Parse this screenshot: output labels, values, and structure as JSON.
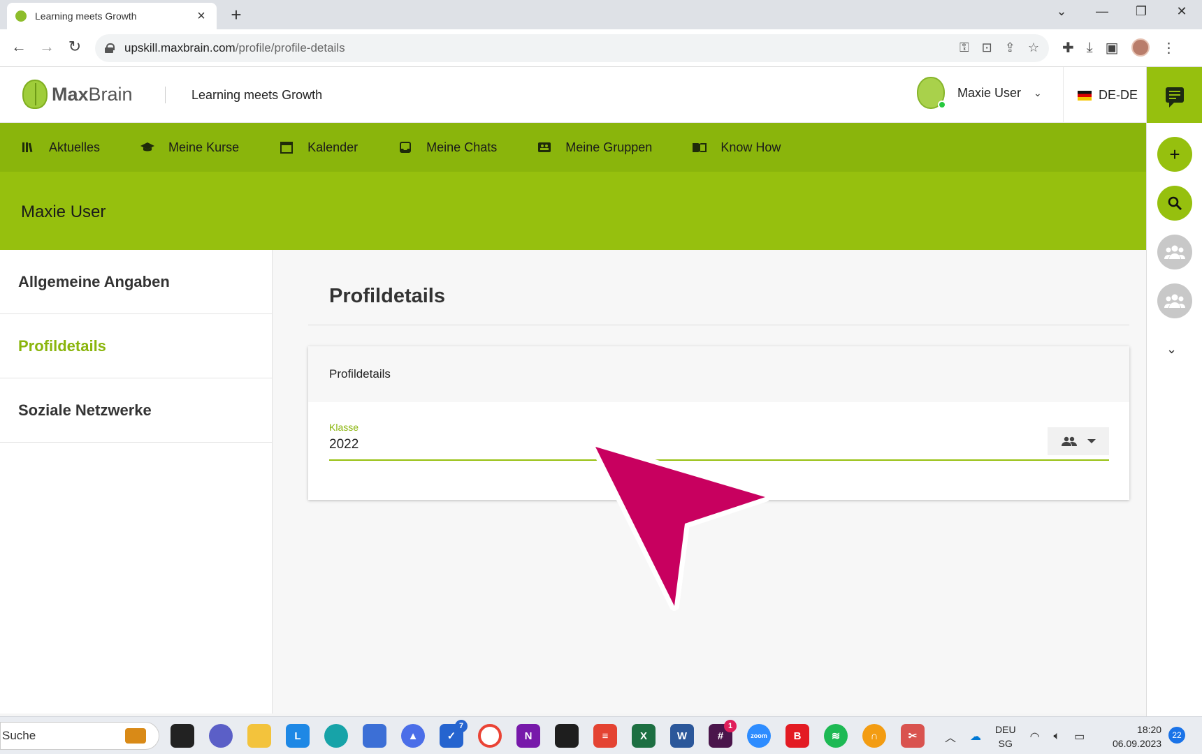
{
  "browser": {
    "tab_title": "Learning meets Growth",
    "url_host": "upskill.maxbrain.com",
    "url_path": "/profile/profile-details"
  },
  "header": {
    "logo_bold": "Max",
    "logo_light": "Brain",
    "tagline": "Learning meets Growth",
    "user_name": "Maxie User",
    "language": "DE-DE"
  },
  "nav": {
    "items": [
      {
        "label": "Aktuelles",
        "icon": "library-icon"
      },
      {
        "label": "Meine Kurse",
        "icon": "graduation-cap-icon"
      },
      {
        "label": "Kalender",
        "icon": "calendar-icon"
      },
      {
        "label": "Meine Chats",
        "icon": "inbox-icon"
      },
      {
        "label": "Meine Gruppen",
        "icon": "group-card-icon"
      },
      {
        "label": "Know How",
        "icon": "book-icon"
      }
    ]
  },
  "banner": {
    "title": "Maxie User"
  },
  "sidebar": {
    "items": [
      {
        "label": "Allgemeine Angaben",
        "active": false
      },
      {
        "label": "Profildetails",
        "active": true
      },
      {
        "label": "Soziale Netzwerke",
        "active": false
      }
    ]
  },
  "main": {
    "title": "Profildetails",
    "card": {
      "header": "Profildetails",
      "field_label": "Klasse",
      "field_value": "2022"
    }
  },
  "colors": {
    "brand_green": "#96c00e",
    "nav_green": "#8ab50c",
    "annotation_arrow": "#c8005f"
  },
  "taskbar": {
    "search_label": "Suche",
    "todo_badge": "7",
    "slack_badge": "1",
    "tray_lang_top": "DEU",
    "tray_lang_bottom": "SG",
    "time": "18:20",
    "date": "06.09.2023",
    "notifications": "22"
  }
}
